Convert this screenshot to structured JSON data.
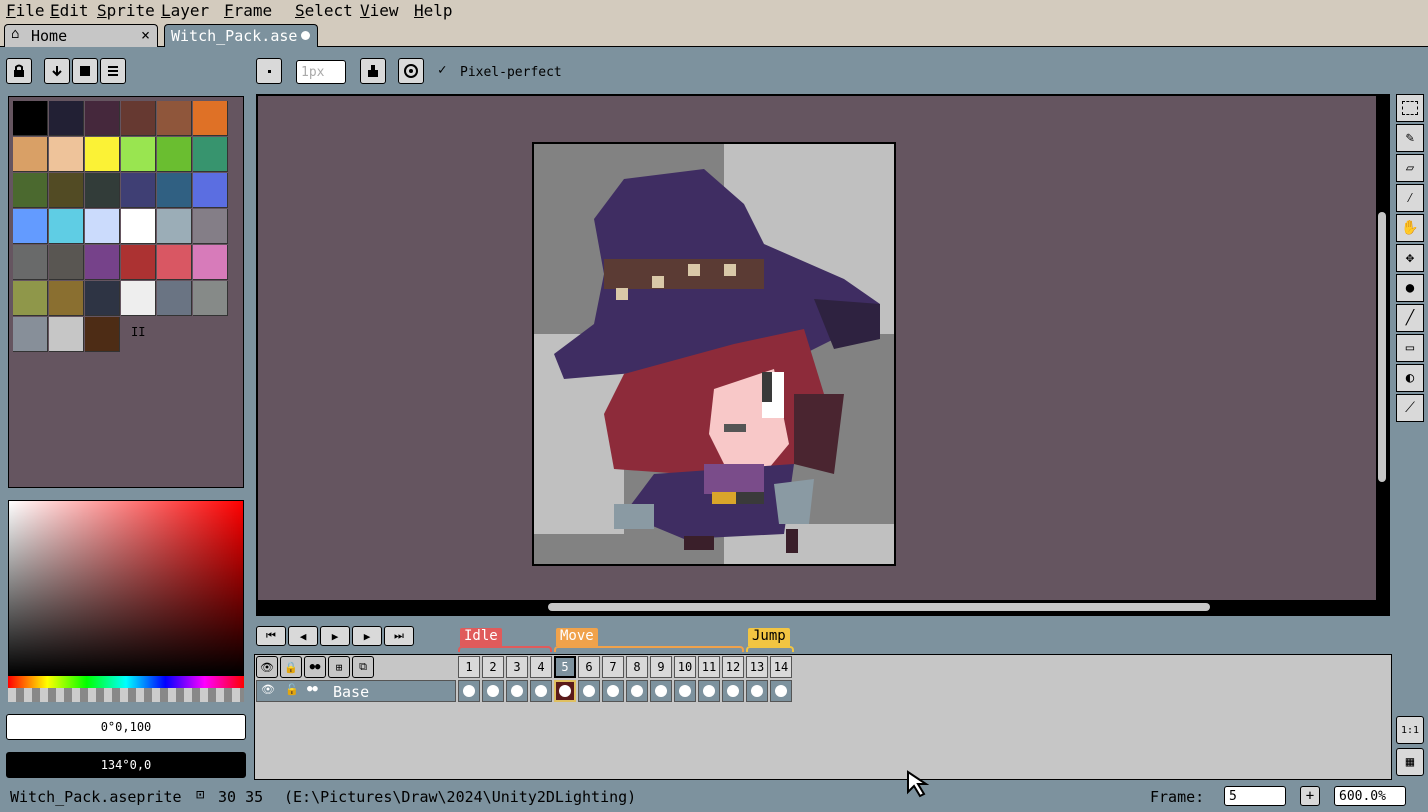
{
  "menu": [
    "File",
    "Edit",
    "Sprite",
    "Layer",
    "Frame",
    "Select",
    "View",
    "Help"
  ],
  "tabs": {
    "home": "Home",
    "file": "Witch_Pack.ase"
  },
  "toolbar": {
    "brush_size": "1px",
    "pixel_perfect_label": "Pixel-perfect",
    "pixel_perfect_checked": true
  },
  "palette": {
    "colors": [
      "#000000",
      "#222034",
      "#45283c",
      "#663931",
      "#8f563b",
      "#df7126",
      "#d9a066",
      "#eec39a",
      "#fbf236",
      "#99e550",
      "#6abe30",
      "#37946e",
      "#4b692f",
      "#524b24",
      "#323c39",
      "#3f3f74",
      "#306082",
      "#5b6ee1",
      "#639bff",
      "#5fcde4",
      "#cbdbfc",
      "#ffffff",
      "#9badb7",
      "#847e87",
      "#696a6a",
      "#595652",
      "#76428a",
      "#ac3232",
      "#d95763",
      "#d77bba",
      "#8f974a",
      "#8a6f30",
      "#2e3444",
      "#eeeeee",
      "#6a7483",
      "#868a88",
      "#878f99",
      "#c6c6c6",
      "#4d2c15"
    ],
    "page_marker": "II"
  },
  "color_fields": {
    "foreground": "0°0,100",
    "background": "134°0,0"
  },
  "timeline": {
    "tags": [
      {
        "name": "Idle",
        "color": "#e05b5b"
      },
      {
        "name": "Move",
        "color": "#f0a24b"
      },
      {
        "name": "Jump",
        "color": "#f2c542"
      }
    ],
    "frames": [
      "1",
      "2",
      "3",
      "4",
      "5",
      "6",
      "7",
      "8",
      "9",
      "10",
      "11",
      "12",
      "13",
      "14"
    ],
    "current_frame": "5",
    "layer_name": "Base"
  },
  "status": {
    "filename": "Witch_Pack.aseprite",
    "size": "30 35",
    "path": "(E:\\Pictures\\Draw\\2024\\Unity2DLighting)",
    "frame_label": "Frame:",
    "frame_value": "5",
    "zoom": "600.0%"
  },
  "zoom_reset_label": "1:1"
}
